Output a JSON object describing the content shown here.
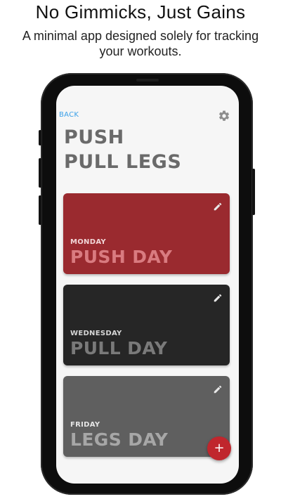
{
  "marketing": {
    "headline": "No Gimmicks, Just Gains",
    "subheadline": "A minimal app designed solely for tracking your workouts."
  },
  "app": {
    "back_label": "BACK",
    "settings_icon": "gear-icon",
    "title_lines": [
      "PUSH",
      "PULL LEGS"
    ],
    "fab_label": "+",
    "workouts": [
      {
        "day": "MONDAY",
        "name": "PUSH DAY",
        "color": "#9a2a2f",
        "day_color": "#f1d6d7",
        "name_color": "#d97b80"
      },
      {
        "day": "WEDNESDAY",
        "name": "PULL DAY",
        "color": "#262626",
        "day_color": "#d6d6d6",
        "name_color": "#7a7a7a"
      },
      {
        "day": "FRIDAY",
        "name": "LEGS DAY",
        "color": "#5f5f5f",
        "day_color": "#e6e6e6",
        "name_color": "#a7a7a7"
      }
    ]
  },
  "colors": {
    "accent_link": "#3aa0e8",
    "fab": "#c0262d",
    "title_text": "#6a6a6a"
  }
}
